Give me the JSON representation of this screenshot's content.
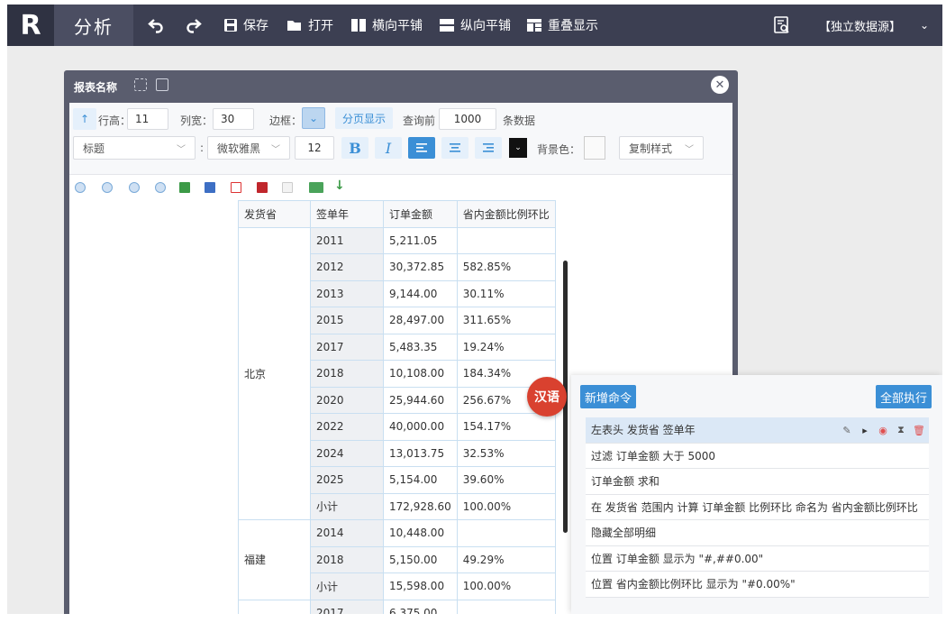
{
  "topbar": {
    "logo": "R",
    "title": "分析",
    "buttons": {
      "save": "保存",
      "open": "打开",
      "tile_h": "横向平铺",
      "tile_v": "纵向平铺",
      "overlap": "重叠显示"
    },
    "datasource": "【独立数据源】"
  },
  "dialog": {
    "title": "报表名称"
  },
  "settings": {
    "row_height_label": "行高：",
    "row_height": "11",
    "col_width_label": "列宽：",
    "col_width": "30",
    "border_label": "边框：",
    "paging": "分页显示",
    "query_before_label": "查询前",
    "query_count": "1000",
    "query_after_label": "条数据",
    "style_select": "标题",
    "font_select": "微软雅黑",
    "font_size": "12",
    "bold": "B",
    "italic": "I",
    "bg_label": "背景色：",
    "copy_style": "复制样式"
  },
  "table": {
    "headers": [
      "发货省",
      "签单年",
      "订单金额",
      "省内金额比例环比"
    ],
    "groups": [
      {
        "province": "北京",
        "rows": [
          [
            "2011",
            "5,211.05",
            ""
          ],
          [
            "2012",
            "30,372.85",
            "582.85%"
          ],
          [
            "2013",
            "9,144.00",
            "30.11%"
          ],
          [
            "2015",
            "28,497.00",
            "311.65%"
          ],
          [
            "2017",
            "5,483.35",
            "19.24%"
          ],
          [
            "2018",
            "10,108.00",
            "184.34%"
          ],
          [
            "2020",
            "25,944.60",
            "256.67%"
          ],
          [
            "2022",
            "40,000.00",
            "154.17%"
          ],
          [
            "2024",
            "13,013.75",
            "32.53%"
          ],
          [
            "2025",
            "5,154.00",
            "39.60%"
          ],
          [
            "小计",
            "172,928.60",
            "100.00%"
          ]
        ]
      },
      {
        "province": "福建",
        "rows": [
          [
            "2014",
            "10,448.00",
            ""
          ],
          [
            "2018",
            "5,150.00",
            "49.29%"
          ],
          [
            "小计",
            "15,598.00",
            "100.00%"
          ]
        ]
      },
      {
        "province": "",
        "rows": [
          [
            "2017",
            "6,375.00",
            ""
          ]
        ]
      }
    ]
  },
  "panel": {
    "lang_badge": "汉语",
    "add_command": "新增命令",
    "run_all": "全部执行",
    "commands": [
      "左表头 发货省 签单年",
      "过滤 订单金额 大于 5000",
      "订单金额 求和",
      "在 发货省 范围内 计算 订单金额 比例环比 命名为 省内金额比例环比",
      "隐藏全部明细",
      "位置 订单金额 显示为 \"#,##0.00\"",
      "位置 省内金额比例环比 显示为 \"#0.00%\""
    ]
  },
  "colors": {
    "topbar": "#3c3f52",
    "accent": "#3b8fd6",
    "badge": "#d9412f",
    "dialog_frame": "#5a5d6e"
  }
}
